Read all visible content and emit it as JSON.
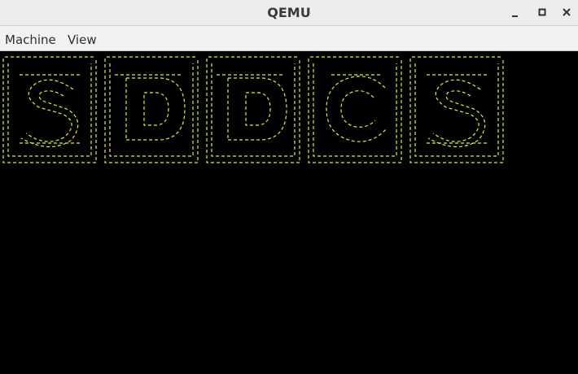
{
  "window": {
    "title": "QEMU"
  },
  "menubar": {
    "items": [
      {
        "label": "Machine"
      },
      {
        "label": "View"
      }
    ]
  },
  "screen": {
    "banner_letters": [
      "S",
      "D",
      "D",
      "C",
      "S"
    ],
    "banner_color": "#e8e84a",
    "background": "#000000"
  },
  "colors": {
    "titlebar": "#ececec",
    "menubar": "#f2f2f2"
  },
  "icons": {
    "minimize": "minimize-icon",
    "maximize": "maximize-icon",
    "close": "close-icon"
  }
}
